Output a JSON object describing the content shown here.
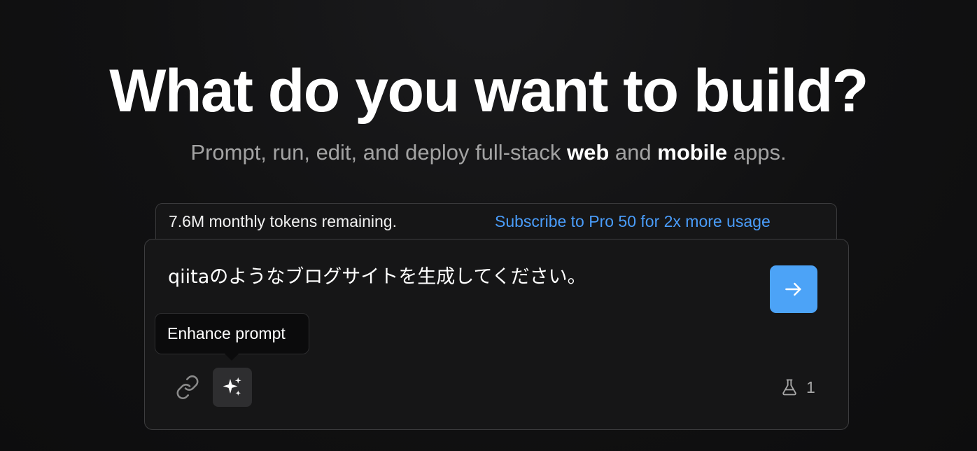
{
  "hero": {
    "title": "What do you want to build?",
    "subtitle_parts": {
      "prefix": "Prompt, run, edit, and deploy full-stack ",
      "bold1": "web",
      "middle": " and ",
      "bold2": "mobile",
      "suffix": " apps."
    }
  },
  "token_bar": {
    "remaining_text": "7.6M monthly tokens remaining.",
    "subscribe_link": "Subscribe to Pro 50 for 2x more usage"
  },
  "composer": {
    "prompt_value": "qiitaのようなブログサイトを生成してください。",
    "send_icon": "arrow-right-icon",
    "tooltip": "Enhance prompt",
    "attach_icon": "link-icon",
    "enhance_icon": "sparkles-icon",
    "experiments_icon": "flask-icon",
    "experiments_count": "1"
  },
  "colors": {
    "accent": "#4ca3f7",
    "link": "#4a9dfb",
    "background": "#111112",
    "panel": "#161617"
  }
}
